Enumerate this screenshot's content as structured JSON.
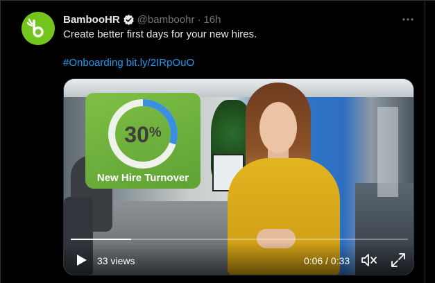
{
  "tweet": {
    "author_name": "BambooHR",
    "handle": "@bamboohr",
    "separator": "·",
    "time": "16h",
    "text": "Create better first days for your new hires.",
    "hashtag": "#Onboarding",
    "link": "bit.ly/2IRpOuO",
    "more_icon": "more-horizontal-icon",
    "verified_icon": "verified-badge-icon"
  },
  "video": {
    "overlay_stat_number": "30",
    "overlay_stat_unit": "%",
    "overlay_stat_label": "New Hire Turnover",
    "overlay_ring_fraction": 0.3,
    "views": "33 views",
    "timecode": "0:06 / 0:33",
    "progress_fraction": 0.18,
    "play_icon": "play-icon",
    "mute_icon": "volume-muted-icon",
    "fullscreen_icon": "fullscreen-icon"
  },
  "colors": {
    "brand_green": "#73c41d",
    "link_blue": "#1d9bf0",
    "muted_text": "#71767b",
    "ring_blue": "#3a8fe0"
  }
}
